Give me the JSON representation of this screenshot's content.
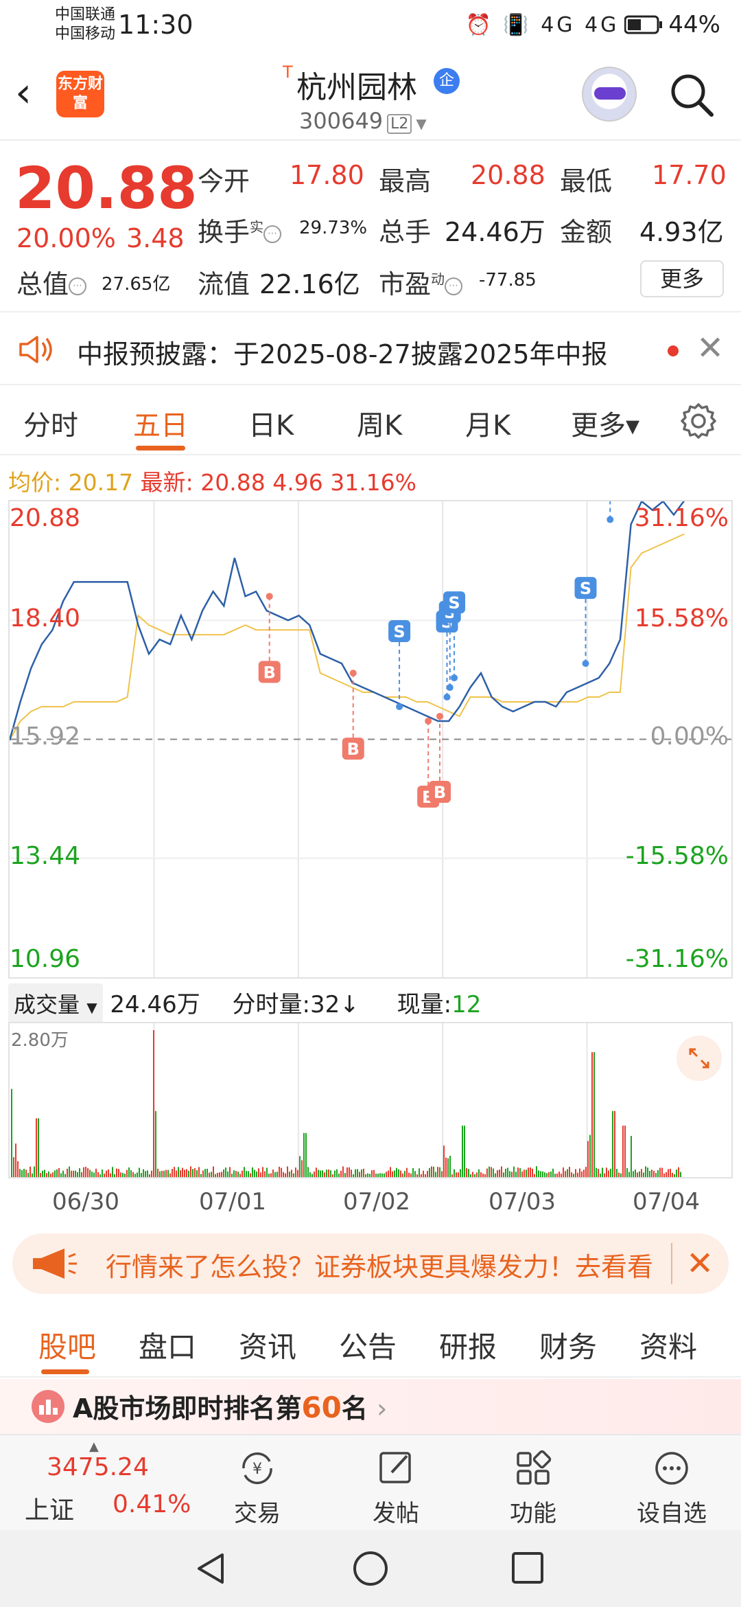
{
  "status_bar": {
    "carrier1": "中国联通",
    "carrier2": "中国移动",
    "time": "11:30",
    "icons": "⏰ 📳 4G 4G",
    "battery": "44%"
  },
  "header": {
    "logo_text": "东方财富",
    "t_mark": "T",
    "title": "杭州园林",
    "badge": "企",
    "code": "300649",
    "l2": "L2"
  },
  "quote": {
    "price": "20.88",
    "change_pct": "20.00%",
    "change_amt": "3.48",
    "open_label": "今开",
    "open": "17.80",
    "high_label": "最高",
    "high": "20.88",
    "low_label": "最低",
    "low": "17.70",
    "turnover_label": "换手",
    "turnover_sup": "实",
    "turnover": "29.73%",
    "vol_label": "总手",
    "vol": "24.46万",
    "amount_label": "金额",
    "amount": "4.93亿",
    "mktcap_label": "总值",
    "mktcap": "27.65亿",
    "float_label": "流值",
    "float": "22.16亿",
    "pe_label": "市盈",
    "pe_sup": "动",
    "pe": "-77.85",
    "more": "更多"
  },
  "notice": {
    "text": "中报预披露：于2025-08-27披露2025年中报"
  },
  "tabs": [
    "分时",
    "五日",
    "日K",
    "周K",
    "月K",
    "更多▾"
  ],
  "avg": {
    "avg_label": "均价:",
    "avg_value": "20.17",
    "last_label": "最新:",
    "last_value": "20.88",
    "last_chg": "4.96",
    "last_pct": "31.16%"
  },
  "chart_data": {
    "type": "line",
    "title": "",
    "x": [
      "06/30",
      "07/01",
      "07/02",
      "07/03",
      "07/04"
    ],
    "y_left_ticks": [
      "20.88",
      "18.40",
      "15.92",
      "13.44",
      "10.96"
    ],
    "y_right_ticks": [
      "31.16%",
      "15.58%",
      "0.00%",
      "-15.58%",
      "-31.16%"
    ],
    "ylim": [
      10.96,
      20.88
    ],
    "prev_close": 15.92,
    "series": [
      {
        "values": [
          15.9,
          16.7,
          17.4,
          17.9,
          18.2,
          18.8,
          19.2,
          19.2,
          19.2,
          19.2,
          19.2,
          19.2,
          18.3,
          17.7,
          18.0,
          17.9,
          18.5,
          18.0,
          18.6,
          19.0,
          18.7,
          19.7,
          18.9,
          19.0,
          18.6,
          18.5,
          18.4,
          18.5,
          18.3,
          17.7,
          17.6,
          17.5,
          17.1,
          17.0,
          16.9,
          16.8,
          16.7,
          16.6,
          16.5,
          16.4,
          16.3,
          16.3,
          16.6,
          17.0,
          17.3,
          16.8,
          16.6,
          16.5,
          16.6,
          16.7,
          16.7,
          16.6,
          16.9,
          17.0,
          17.1,
          17.2,
          17.5,
          18.0,
          20.4,
          20.88,
          20.7,
          20.88,
          20.6,
          20.9
        ]
      },
      {
        "values": [
          15.9,
          16.3,
          16.5,
          16.6,
          16.6,
          16.6,
          16.7,
          16.7,
          16.7,
          16.7,
          16.7,
          16.8,
          18.5,
          18.3,
          18.2,
          18.1,
          18.1,
          18.1,
          18.1,
          18.1,
          18.1,
          18.2,
          18.3,
          18.2,
          18.2,
          18.2,
          18.2,
          18.2,
          18.2,
          17.3,
          17.2,
          17.1,
          17.0,
          16.9,
          16.9,
          16.8,
          16.8,
          16.8,
          16.7,
          16.7,
          16.6,
          16.5,
          16.4,
          16.8,
          16.8,
          16.8,
          16.7,
          16.7,
          16.7,
          16.7,
          16.7,
          16.7,
          16.7,
          16.7,
          16.8,
          16.8,
          16.9,
          16.9,
          19.5,
          19.8,
          19.9,
          20.0,
          20.1,
          20.2
        ]
      }
    ],
    "markers": [
      {
        "label": "B",
        "day": 1,
        "frac": 0.8,
        "price": 18.9
      },
      {
        "label": "B",
        "day": 2,
        "frac": 0.38,
        "price": 17.3
      },
      {
        "label": "B",
        "day": 2,
        "frac": 0.9,
        "price": 16.3
      },
      {
        "label": "B",
        "day": 2,
        "frac": 0.98,
        "price": 16.4
      },
      {
        "label": "S",
        "day": 2,
        "frac": 0.7,
        "price": 16.6
      },
      {
        "label": "S",
        "day": 3,
        "frac": 0.03,
        "price": 16.8
      },
      {
        "label": "S",
        "day": 3,
        "frac": 0.05,
        "price": 17.0
      },
      {
        "label": "S",
        "day": 3,
        "frac": 0.08,
        "price": 17.2
      },
      {
        "label": "S",
        "day": 3,
        "frac": 0.99,
        "price": 17.5
      },
      {
        "label": "S",
        "day": 4,
        "frac": 0.16,
        "price": 20.5
      }
    ]
  },
  "volume": {
    "selector": "成交量",
    "total": "24.46万",
    "period_label": "分时量:",
    "period_value": "32↓",
    "current_label": "现量:",
    "current_value": "12",
    "max_label": "2.80万"
  },
  "dates": [
    "06/30",
    "07/01",
    "07/02",
    "07/03",
    "07/04"
  ],
  "banner": {
    "text": "行情来了怎么投？证券板块更具爆发力！去看看"
  },
  "bottom_tabs": [
    "股吧",
    "盘口",
    "资讯",
    "公告",
    "研报",
    "财务",
    "资料"
  ],
  "rank": {
    "prefix": "A股市场即时排名第",
    "number": "60",
    "suffix": "名"
  },
  "index": {
    "value": "3475.24",
    "name": "上证",
    "change": "0.41%"
  },
  "nav": [
    {
      "label": "交易",
      "icon": "trade-icon"
    },
    {
      "label": "发帖",
      "icon": "post-icon"
    },
    {
      "label": "功能",
      "icon": "apps-icon"
    },
    {
      "label": "设自选",
      "icon": "more-dots-icon"
    }
  ],
  "colors": {
    "up": "#e63b2e",
    "down": "#1ca31f",
    "accent": "#e8631f",
    "price_line": "#2d5fa8",
    "avg_line": "#f0c24a"
  }
}
